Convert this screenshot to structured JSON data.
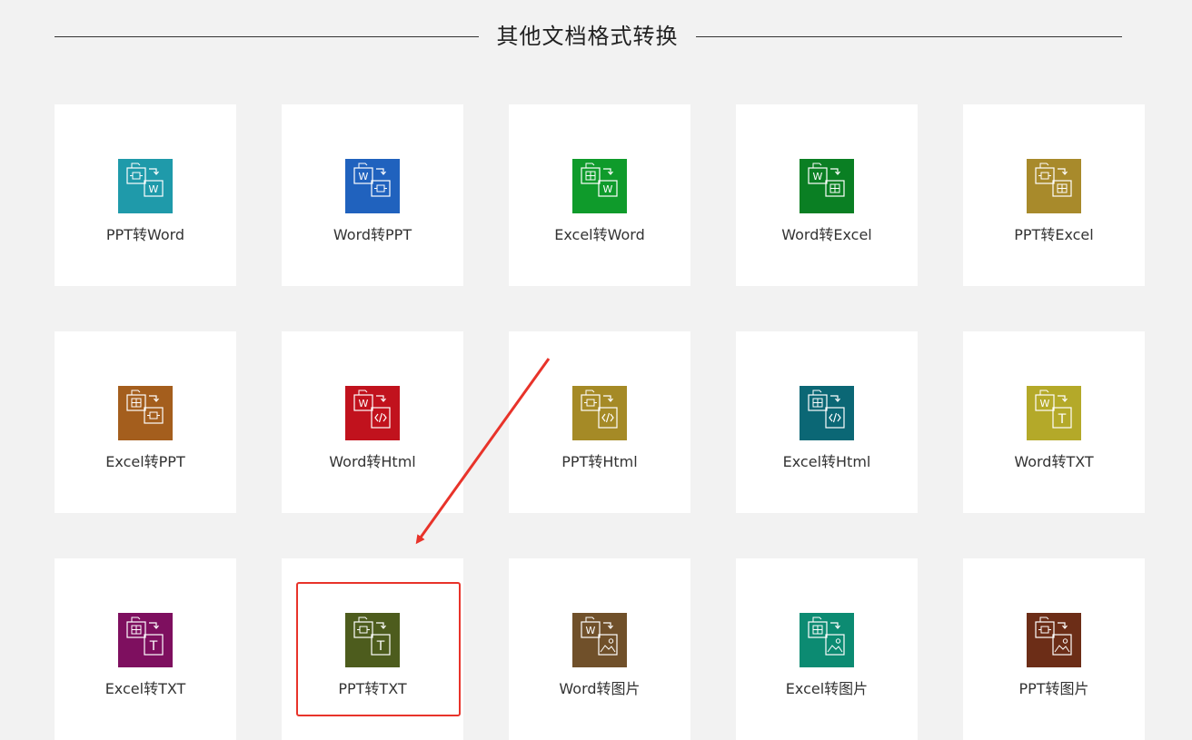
{
  "header": {
    "title": "其他文档格式转换"
  },
  "cards": [
    {
      "label": "PPT转Word",
      "from": "ppt",
      "to": "word",
      "color": "#1f9aaa"
    },
    {
      "label": "Word转PPT",
      "from": "word",
      "to": "ppt",
      "color": "#2062be"
    },
    {
      "label": "Excel转Word",
      "from": "excel",
      "to": "word",
      "color": "#0f9b2b"
    },
    {
      "label": "Word转Excel",
      "from": "word",
      "to": "excel",
      "color": "#0a7f23"
    },
    {
      "label": "PPT转Excel",
      "from": "ppt",
      "to": "excel",
      "color": "#a88a2b"
    },
    {
      "label": "Excel转PPT",
      "from": "excel",
      "to": "ppt",
      "color": "#a45e1d"
    },
    {
      "label": "Word转Html",
      "from": "word",
      "to": "html",
      "color": "#c1121d"
    },
    {
      "label": "PPT转Html",
      "from": "ppt",
      "to": "html",
      "color": "#a58a26"
    },
    {
      "label": "Excel转Html",
      "from": "excel",
      "to": "html",
      "color": "#0b6775"
    },
    {
      "label": "Word转TXT",
      "from": "word",
      "to": "txt",
      "color": "#b4a929"
    },
    {
      "label": "Excel转TXT",
      "from": "excel",
      "to": "txt",
      "color": "#7e0f5f"
    },
    {
      "label": "PPT转TXT",
      "from": "ppt",
      "to": "txt",
      "color": "#4d5c1d"
    },
    {
      "label": "Word转图片",
      "from": "word",
      "to": "image",
      "color": "#70502a"
    },
    {
      "label": "Excel转图片",
      "from": "excel",
      "to": "image",
      "color": "#0c8b72"
    },
    {
      "label": "PPT转图片",
      "from": "ppt",
      "to": "image",
      "color": "#6c2d17"
    }
  ],
  "annotation": {
    "highlight_color": "#e8332a",
    "highlighted_card": "PPT转TXT"
  }
}
